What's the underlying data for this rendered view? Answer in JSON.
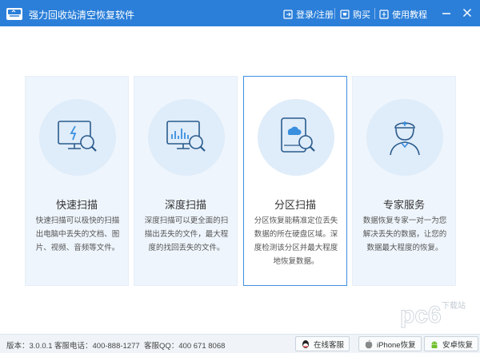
{
  "app": {
    "title": "强力回收站清空恢复软件",
    "login_label": "登录/注册",
    "buy_label": "购买",
    "tutorial_label": "使用教程",
    "accent_color": "#2b7fd9"
  },
  "cards": [
    {
      "icon": "monitor-scan-icon",
      "title": "快速扫描",
      "desc": "快速扫描可以极快的扫描出电脑中丢失的文档、图片、视频、音频等文件。"
    },
    {
      "icon": "chart-scan-icon",
      "title": "深度扫描",
      "desc": "深度扫描可以更全面的扫描出丢失的文件，最大程度的找回丢失的文件。"
    },
    {
      "icon": "drive-scan-icon",
      "title": "分区扫描",
      "desc": "分区恢复能精准定位丢失数据的所在硬盘区域。深度检测该分区并最大程度地恢复数据。"
    },
    {
      "icon": "expert-icon",
      "title": "专家服务",
      "desc": "数据恢复专家一对一为您解决丢失的数据，让您的数据最大程度的恢复。"
    }
  ],
  "status": {
    "version": "版本：3.0.0.1",
    "phone": "客服电话：400-888-1277",
    "qq": "客服QQ：400 671 8068",
    "online_service": "在线客服",
    "iphone_recover": "iPhone恢复",
    "android_recover": "安卓恢复"
  }
}
